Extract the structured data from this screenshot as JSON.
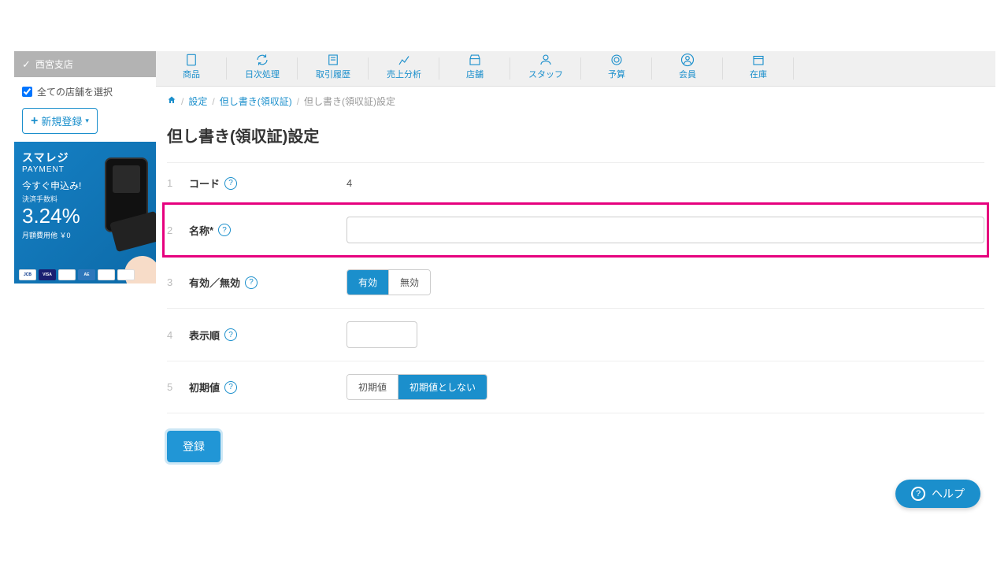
{
  "sidebar": {
    "store_label": "西宮支店",
    "all_stores_label": "全ての店舗を選択",
    "new_register_label": "新規登録",
    "promo": {
      "brand1": "スマレジ",
      "brand2": "PAYMENT",
      "apply": "今すぐ申込み!",
      "fee_label": "決済手数料",
      "rate": "3.24%",
      "monthly": "月額費用他 ￥0"
    }
  },
  "topnav": [
    {
      "label": "商品"
    },
    {
      "label": "日次処理"
    },
    {
      "label": "取引履歴"
    },
    {
      "label": "売上分析"
    },
    {
      "label": "店舗"
    },
    {
      "label": "スタッフ"
    },
    {
      "label": "予算"
    },
    {
      "label": "会員"
    },
    {
      "label": "在庫"
    }
  ],
  "breadcrumb": {
    "settings": "設定",
    "parent": "但し書き(領収証)",
    "current": "但し書き(領収証)設定"
  },
  "page_title": "但し書き(領収証)設定",
  "form": {
    "row1": {
      "num": "1",
      "label": "コード",
      "value": "4"
    },
    "row2": {
      "num": "2",
      "label": "名称",
      "required": "*"
    },
    "row3": {
      "num": "3",
      "label": "有効／無効",
      "opt_on": "有効",
      "opt_off": "無効"
    },
    "row4": {
      "num": "4",
      "label": "表示順"
    },
    "row5": {
      "num": "5",
      "label": "初期値",
      "opt_on": "初期値",
      "opt_off": "初期値としない"
    }
  },
  "submit_label": "登録",
  "help_label": "ヘルプ"
}
